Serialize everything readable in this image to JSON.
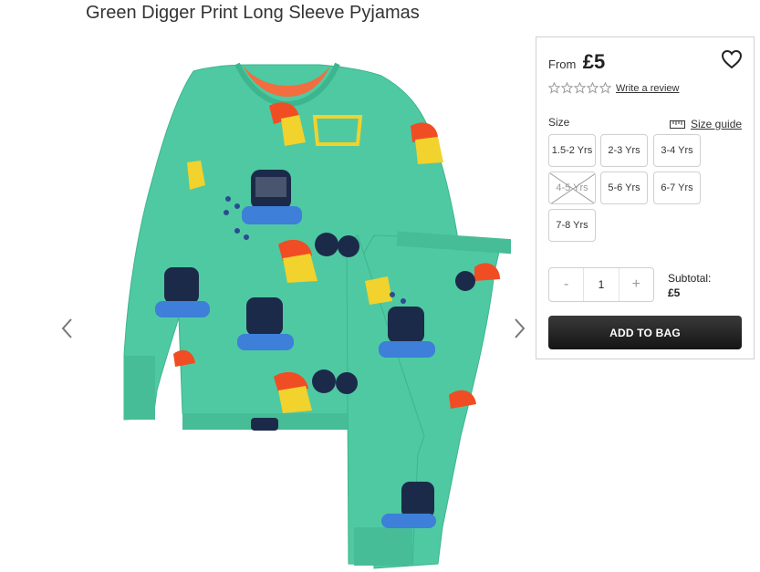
{
  "product": {
    "title": "Green Digger Print Long Sleeve Pyjamas"
  },
  "gallery": {
    "prev_icon": "chevron-left-icon",
    "next_icon": "chevron-right-icon"
  },
  "purchase": {
    "from_label": "From",
    "price": "£5",
    "wishlist_icon": "heart-icon",
    "rating_stars": 0,
    "write_review": "Write a review",
    "size_label": "Size",
    "size_guide": "Size guide",
    "sizes": [
      {
        "label": "1.5-2 Yrs",
        "available": true
      },
      {
        "label": "2-3 Yrs",
        "available": true
      },
      {
        "label": "3-4 Yrs",
        "available": true
      },
      {
        "label": "4-5 Yrs",
        "available": false
      },
      {
        "label": "5-6 Yrs",
        "available": true
      },
      {
        "label": "6-7 Yrs",
        "available": true
      },
      {
        "label": "7-8 Yrs",
        "available": true
      }
    ],
    "quantity": {
      "decrement": "-",
      "value": "1",
      "increment": "+"
    },
    "subtotal_label": "Subtotal:",
    "subtotal_value": "£5",
    "add_to_bag": "ADD TO BAG"
  },
  "colors": {
    "pyjama_green": "#4fc9a2",
    "button_dark": "#222222"
  }
}
